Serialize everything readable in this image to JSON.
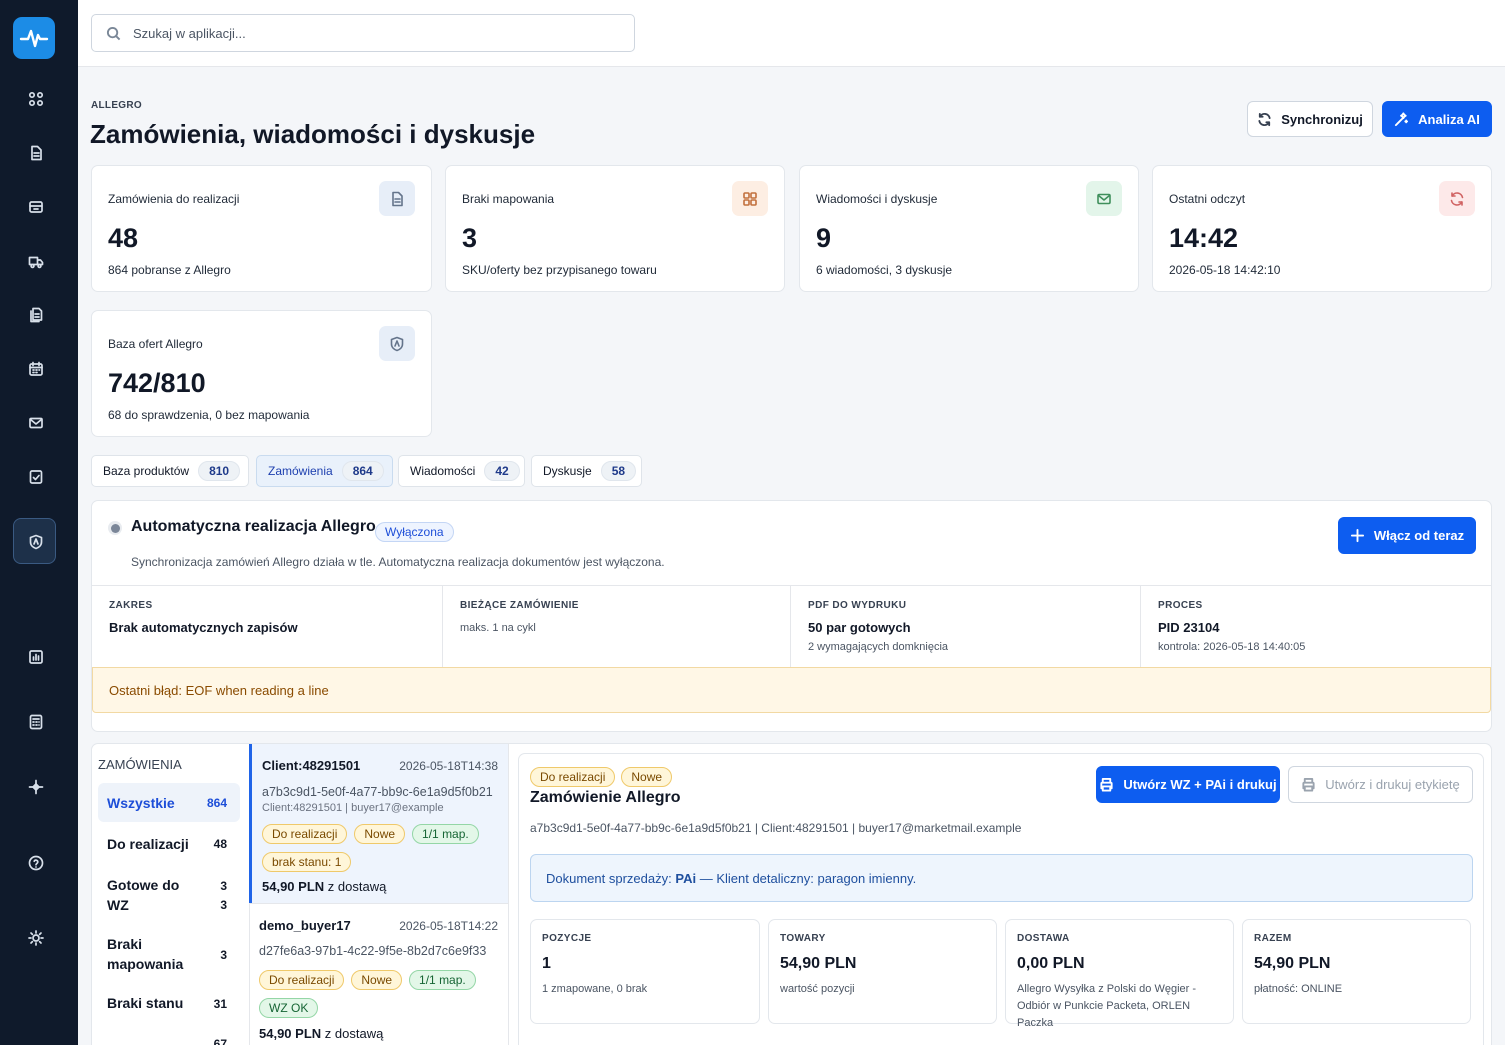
{
  "search": {
    "placeholder": "Szukaj w aplikacji..."
  },
  "header": {
    "eyebrow": "ALLEGRO",
    "title": "Zamówienia, wiadomości i dyskusje",
    "sync_label": "Synchronizuj",
    "ai_label": "Analiza AI"
  },
  "stats": [
    {
      "label": "Zamówienia do realizacji",
      "value": "48",
      "sub": "864 pobranse z Allegro",
      "icon": "document-icon",
      "color": "#e7eef8"
    },
    {
      "label": "Braki mapowania",
      "value": "3",
      "sub": "SKU/oferty bez przypisanego towaru",
      "icon": "grid-icon",
      "color": "#fdeee3"
    },
    {
      "label": "Wiadomości i dyskusje",
      "value": "9",
      "sub": "6 wiadomości, 3 dyskusje",
      "icon": "mail-icon",
      "color": "#e3f5ea"
    },
    {
      "label": "Ostatni odczyt",
      "value": "14:42",
      "sub": "2026-05-18 14:42:10",
      "icon": "refresh-icon",
      "color": "#fde9e9"
    },
    {
      "label": "Baza ofert Allegro",
      "value": "742/810",
      "sub": "68 do sprawdzenia, 0 bez mapowania",
      "icon": "shield-icon",
      "color": "#e7eef8"
    }
  ],
  "tabs": [
    {
      "label": "Baza produktów",
      "count": "810"
    },
    {
      "label": "Zamówienia",
      "count": "864"
    },
    {
      "label": "Wiadomości",
      "count": "42"
    },
    {
      "label": "Dyskusje",
      "count": "58"
    }
  ],
  "auto": {
    "title": "Automatyczna realizacja Allegro",
    "status": "Wyłączona",
    "desc": "Synchronizacja zamówień Allegro działa w tle. Automatyczna realizacja dokumentów jest wyłączona.",
    "button": "Włącz od teraz",
    "cols": [
      {
        "h": "ZAKRES",
        "v": "Brak automatycznych zapisów",
        "s": ""
      },
      {
        "h": "BIEŻĄCE ZAMÓWIENIE",
        "v": "",
        "s": "maks. 1 na cykl"
      },
      {
        "h": "PDF DO WYDRUKU",
        "v": "50 par gotowych",
        "s": "2 wymagających domknięcia"
      },
      {
        "h": "PROCES",
        "v": "PID 23104",
        "s": "kontrola: 2026-05-18 14:40:05"
      }
    ],
    "error": "Ostatni błąd: EOF when reading a line"
  },
  "filters": {
    "title": "ZAMÓWIENIA",
    "items": [
      {
        "label": "Wszystkie",
        "count": "864"
      },
      {
        "label": "Do realizacji",
        "count": "48"
      },
      {
        "label_line1": "Gotowe do",
        "label_line2": "WZ",
        "count1": "3",
        "count2": "3"
      },
      {
        "label_line1": "Braki",
        "label_line2": "mapowania",
        "count": "3"
      },
      {
        "label": "Braki stanu",
        "count": "31"
      },
      {
        "count": "67"
      }
    ]
  },
  "orders": [
    {
      "client": "Client:48291501",
      "date": "2026-05-18T14:38",
      "hash": "a7b3c9d1-5e0f-4a77-bb9c-6e1a9d5f0b21",
      "mini": "Client:48291501 | buyer17@example",
      "badges": [
        "Do realizacji",
        "Nowe",
        "1/1 map."
      ],
      "extra": "brak stanu: 1",
      "price": "54,90 PLN",
      "price_suffix": "z dostawą"
    },
    {
      "client": "demo_buyer17",
      "date": "2026-05-18T14:22",
      "hash": "d27fe6a3-97b1-4c22-9f5e-8b2d7c6e9f33",
      "badges": [
        "Do realizacji",
        "Nowe",
        "1/1 map."
      ],
      "extra": "WZ OK",
      "price": "54,90 PLN",
      "price_suffix": "z dostawą"
    }
  ],
  "detail": {
    "badges": [
      "Do realizacji",
      "Nowe"
    ],
    "title": "Zamówienie Allegro",
    "meta": "a7b3c9d1-5e0f-4a77-bb9c-6e1a9d5f0b21 | Client:48291501 | buyer17@marketmail.example",
    "btn_primary": "Utwórz WZ + PAi i drukuj",
    "btn_secondary": "Utwórz i drukuj etykietę",
    "doc_prefix": "Dokument sprzedaży:",
    "doc_code": "PAi",
    "doc_rest": "— Klient detaliczny: paragon imienny.",
    "cards": [
      {
        "h": "POZYCJE",
        "v": "1",
        "s": "1 zmapowane, 0 brak"
      },
      {
        "h": "TOWARY",
        "v": "54,90 PLN",
        "s": "wartość pozycji"
      },
      {
        "h": "DOSTAWA",
        "v": "0,00 PLN",
        "s": "Allegro Wysyłka z Polski do Węgier - Odbiór w Punkcie Packeta, ORLEN Paczka"
      },
      {
        "h": "RAZEM",
        "v": "54,90 PLN",
        "s": "płatność: ONLINE"
      }
    ]
  }
}
